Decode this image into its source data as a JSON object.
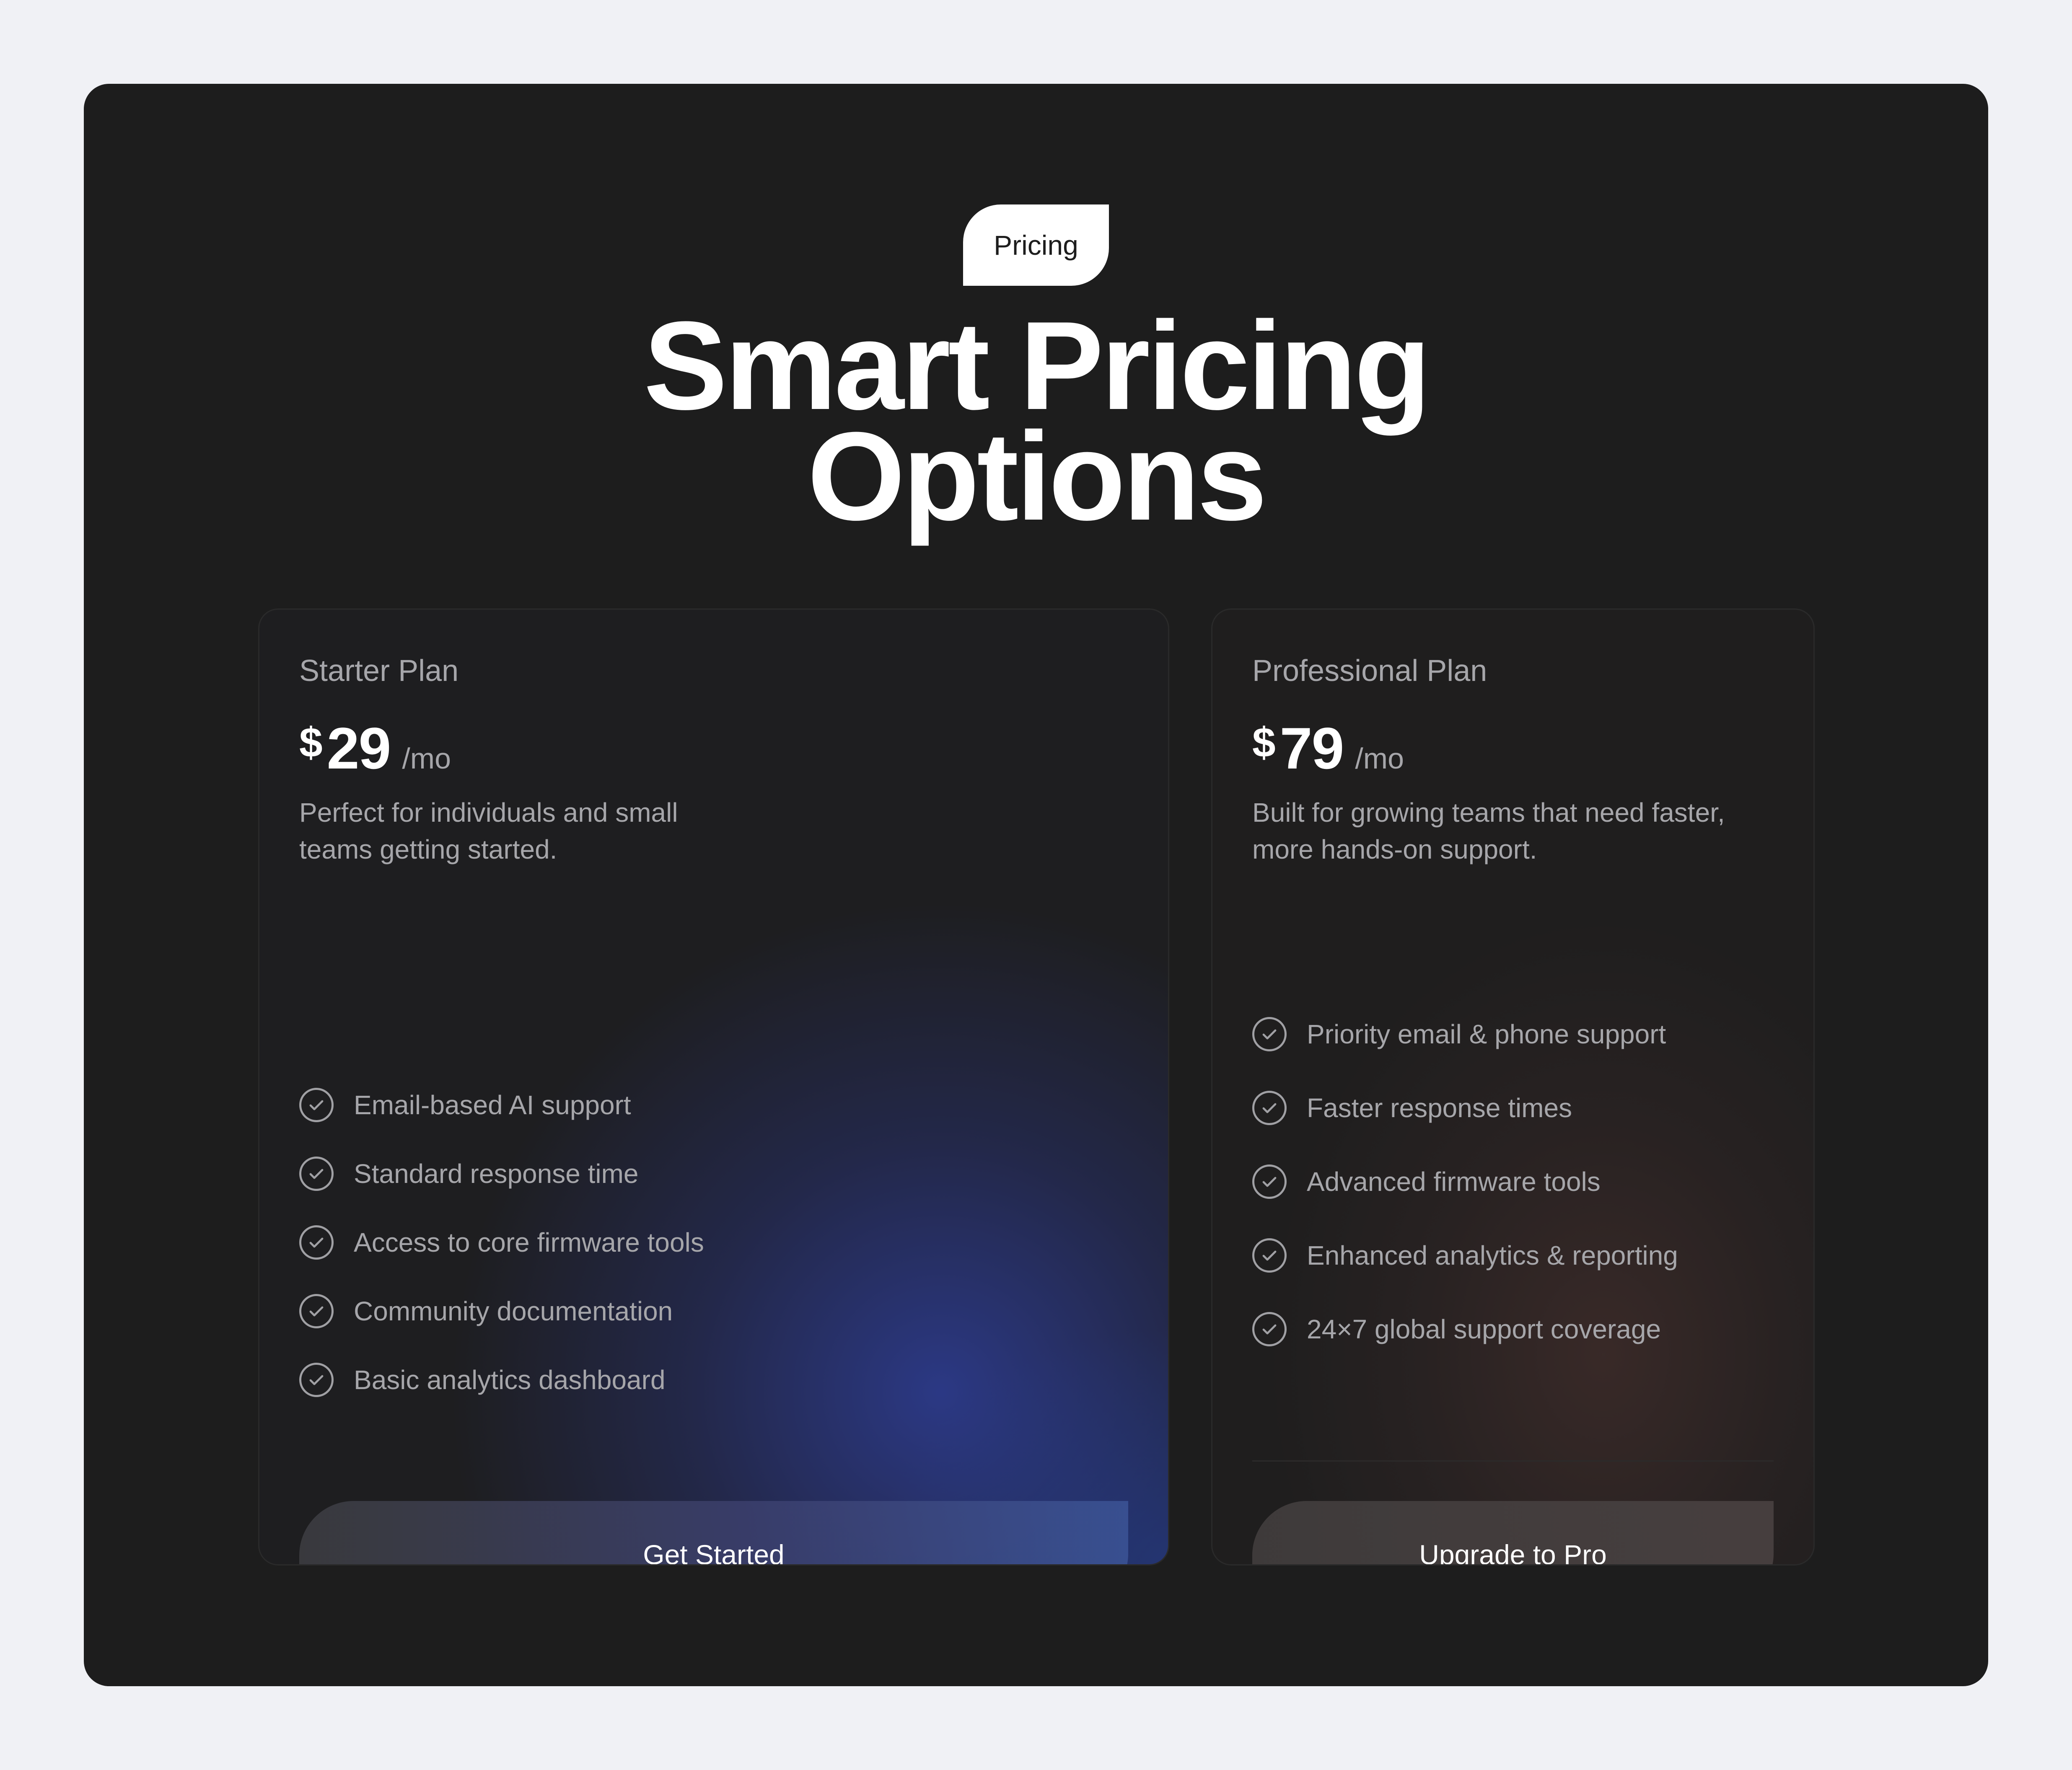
{
  "badge": "Pricing",
  "title": {
    "line1": "Smart Pricing",
    "line2": "Options"
  },
  "plans": [
    {
      "name": "Starter Plan",
      "currency": "$",
      "price": "29",
      "period": "/mo",
      "description_line1": "Perfect for individuals and small",
      "description_line2": "teams getting started.",
      "features": [
        "Email-based AI support",
        "Standard response time",
        "Access to core firmware tools",
        "Community documentation",
        "Basic analytics dashboard"
      ],
      "cta": "Get Started"
    },
    {
      "name": "Professional Plan",
      "currency": "$",
      "price": "79",
      "period": "/mo",
      "description_line1": "Built for growing teams that need faster,",
      "description_line2": "more hands-on support.",
      "features": [
        "Priority email & phone support",
        "Faster response times",
        "Advanced firmware tools",
        "Enhanced analytics & reporting",
        "24×7 global support coverage"
      ],
      "cta": "Upgrade to Pro"
    }
  ],
  "colors": {
    "page_bg": "#f0f1f5",
    "panel_bg": "#1d1d1d",
    "text_primary": "#ffffff",
    "text_muted": "#a6a6aa",
    "starter_accent": "#2c3a8a",
    "pro_accent": "#3a2a28"
  },
  "icons": {
    "feature_check": "check-circle-icon"
  }
}
